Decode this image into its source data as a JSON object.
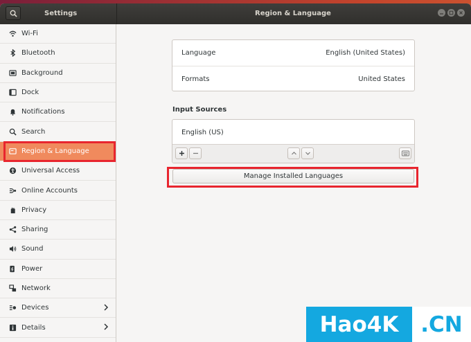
{
  "window": {
    "sidebar_title": "Settings",
    "title": "Region & Language",
    "controls": [
      "minimize",
      "maximize",
      "close"
    ]
  },
  "sidebar": {
    "items": [
      {
        "label": "Wi-Fi",
        "icon": "wifi-icon"
      },
      {
        "label": "Bluetooth",
        "icon": "bluetooth-icon"
      },
      {
        "label": "Background",
        "icon": "background-icon"
      },
      {
        "label": "Dock",
        "icon": "dock-icon"
      },
      {
        "label": "Notifications",
        "icon": "bell-icon"
      },
      {
        "label": "Search",
        "icon": "search-icon"
      },
      {
        "label": "Region & Language",
        "icon": "flag-icon",
        "active": true
      },
      {
        "label": "Universal Access",
        "icon": "accessibility-icon"
      },
      {
        "label": "Online Accounts",
        "icon": "online-accounts-icon"
      },
      {
        "label": "Privacy",
        "icon": "hand-icon"
      },
      {
        "label": "Sharing",
        "icon": "share-icon"
      },
      {
        "label": "Sound",
        "icon": "speaker-icon"
      },
      {
        "label": "Power",
        "icon": "power-icon"
      },
      {
        "label": "Network",
        "icon": "network-icon"
      },
      {
        "label": "Devices",
        "icon": "devices-icon",
        "has_chevron": true
      },
      {
        "label": "Details",
        "icon": "info-icon",
        "has_chevron": true
      }
    ]
  },
  "main": {
    "language": {
      "label": "Language",
      "value": "English (United States)"
    },
    "formats": {
      "label": "Formats",
      "value": "United States"
    },
    "input_sources_title": "Input Sources",
    "input_sources": [
      "English (US)"
    ],
    "manage_button": "Manage Installed Languages"
  },
  "watermark": {
    "left": "Hao4K",
    "right": ".CN"
  },
  "colors": {
    "accent": "#f08a5d",
    "titlebar": "#35342f",
    "highlight": "#e8252e",
    "watermark_blue": "#14a8e0"
  }
}
